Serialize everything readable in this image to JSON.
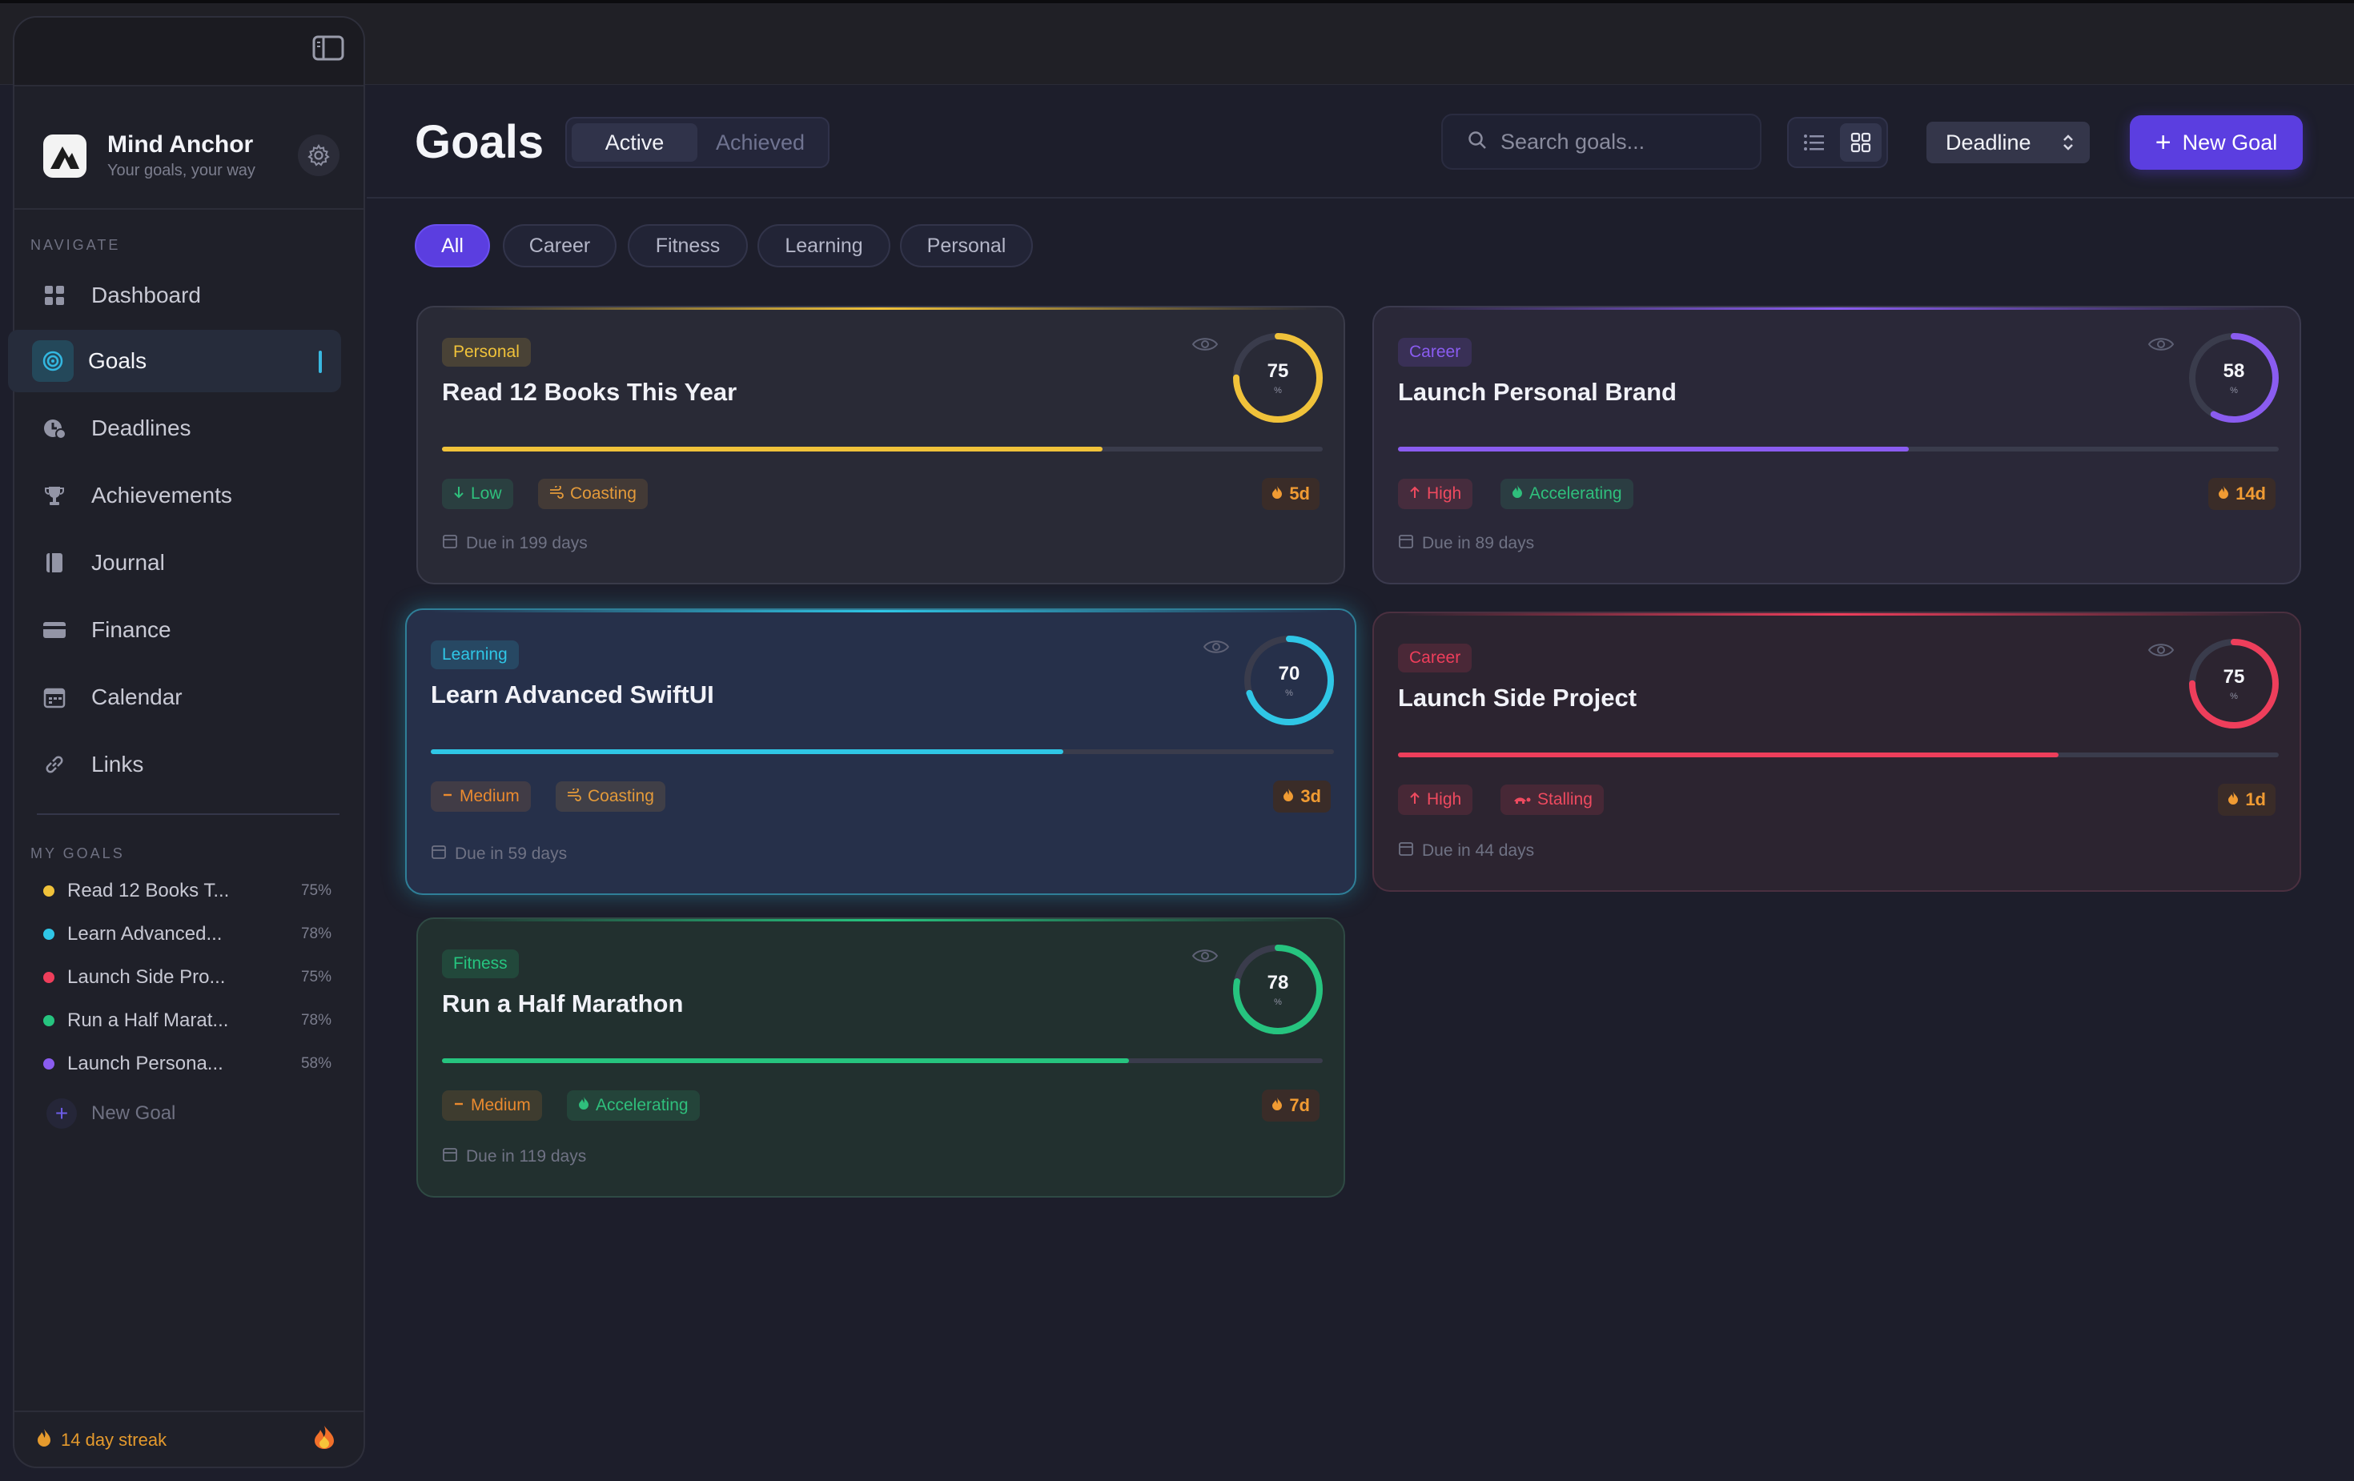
{
  "app": {
    "name": "Mind Anchor",
    "tagline": "Your goals, your way"
  },
  "sidebar": {
    "navigate_label": "NAVIGATE",
    "nav": [
      {
        "label": "Dashboard",
        "icon": "dashboard-grid-icon"
      },
      {
        "label": "Goals",
        "icon": "target-icon",
        "active": true
      },
      {
        "label": "Deadlines",
        "icon": "clock-icon"
      },
      {
        "label": "Achievements",
        "icon": "trophy-icon"
      },
      {
        "label": "Journal",
        "icon": "book-icon"
      },
      {
        "label": "Finance",
        "icon": "credit-card-icon"
      },
      {
        "label": "Calendar",
        "icon": "calendar-icon"
      },
      {
        "label": "Links",
        "icon": "link-icon"
      }
    ],
    "my_goals_label": "MY GOALS",
    "my_goals": [
      {
        "name": "Read 12 Books T...",
        "pct": "75%",
        "color": "#f0c23a"
      },
      {
        "name": "Learn Advanced...",
        "pct": "78%",
        "color": "#2fc6e6"
      },
      {
        "name": "Launch Side Pro...",
        "pct": "75%",
        "color": "#ee3e5b"
      },
      {
        "name": "Run a Half Marat...",
        "pct": "78%",
        "color": "#26c47f"
      },
      {
        "name": "Launch Persona...",
        "pct": "58%",
        "color": "#8a5cf0"
      }
    ],
    "new_goal_label": "New Goal",
    "streak_label": "14 day streak"
  },
  "header": {
    "title": "Goals",
    "tabs": [
      "Active",
      "Achieved"
    ],
    "active_tab": "Active",
    "search_placeholder": "Search goals...",
    "sort_value": "Deadline",
    "new_goal_button": "New Goal"
  },
  "filters": [
    "All",
    "Career",
    "Fitness",
    "Learning",
    "Personal"
  ],
  "active_filter": "All",
  "cards": [
    {
      "category": "Personal",
      "title": "Read 12 Books This Year",
      "progress": 75,
      "unit": "%",
      "priority": "Low",
      "priority_icon": "arrow-down-icon",
      "momentum": "Coasting",
      "momentum_icon": "wind-icon",
      "streak": "5d",
      "due": "Due in 199 days",
      "color": "#f0c23a"
    },
    {
      "category": "Career",
      "title": "Launch Personal Brand",
      "progress": 58,
      "unit": "%",
      "priority": "High",
      "priority_icon": "arrow-up-icon",
      "momentum": "Accelerating",
      "momentum_icon": "flame-icon",
      "streak": "14d",
      "due": "Due in 89 days",
      "color": "#8a5cf0"
    },
    {
      "category": "Learning",
      "title": "Learn Advanced SwiftUI",
      "progress": 70,
      "unit": "%",
      "priority": "Medium",
      "priority_icon": "minus-icon",
      "momentum": "Coasting",
      "momentum_icon": "wind-icon",
      "streak": "3d",
      "due": "Due in 59 days",
      "color": "#2fc6e6"
    },
    {
      "category": "Career",
      "title": "Launch Side Project",
      "progress": 75,
      "unit": "%",
      "priority": "High",
      "priority_icon": "arrow-up-icon",
      "momentum": "Stalling",
      "momentum_icon": "tortoise-icon",
      "streak": "1d",
      "due": "Due in 44 days",
      "color": "#ee3e5b"
    },
    {
      "category": "Fitness",
      "title": "Run a Half Marathon",
      "progress": 78,
      "unit": "%",
      "priority": "Medium",
      "priority_icon": "minus-icon",
      "momentum": "Accelerating",
      "momentum_icon": "flame-icon",
      "streak": "7d",
      "due": "Due in 119 days",
      "color": "#26c47f"
    }
  ]
}
